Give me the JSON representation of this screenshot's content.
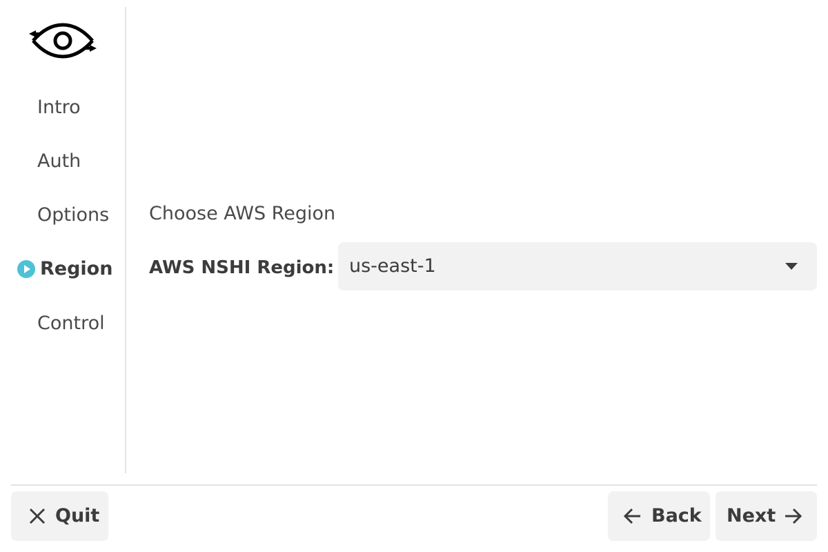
{
  "app": {
    "logo_icon": "eye-with-arrows-logo"
  },
  "sidebar": {
    "items": [
      {
        "label": "Intro",
        "active": false
      },
      {
        "label": "Auth",
        "active": false
      },
      {
        "label": "Options",
        "active": false
      },
      {
        "label": "Region",
        "active": true
      },
      {
        "label": "Control",
        "active": false
      }
    ],
    "active_indicator_icon": "play-circle-icon",
    "active_color": "#4fc1d6"
  },
  "main": {
    "section_title": "Choose AWS Region",
    "region_field": {
      "label": "AWS NSHI Region:",
      "value": "us-east-1",
      "caret_icon": "caret-down-icon"
    }
  },
  "footer": {
    "quit": {
      "label": "Quit",
      "icon": "close-icon"
    },
    "back": {
      "label": "Back",
      "icon": "arrow-left-icon"
    },
    "next": {
      "label": "Next",
      "icon": "arrow-right-icon"
    }
  }
}
